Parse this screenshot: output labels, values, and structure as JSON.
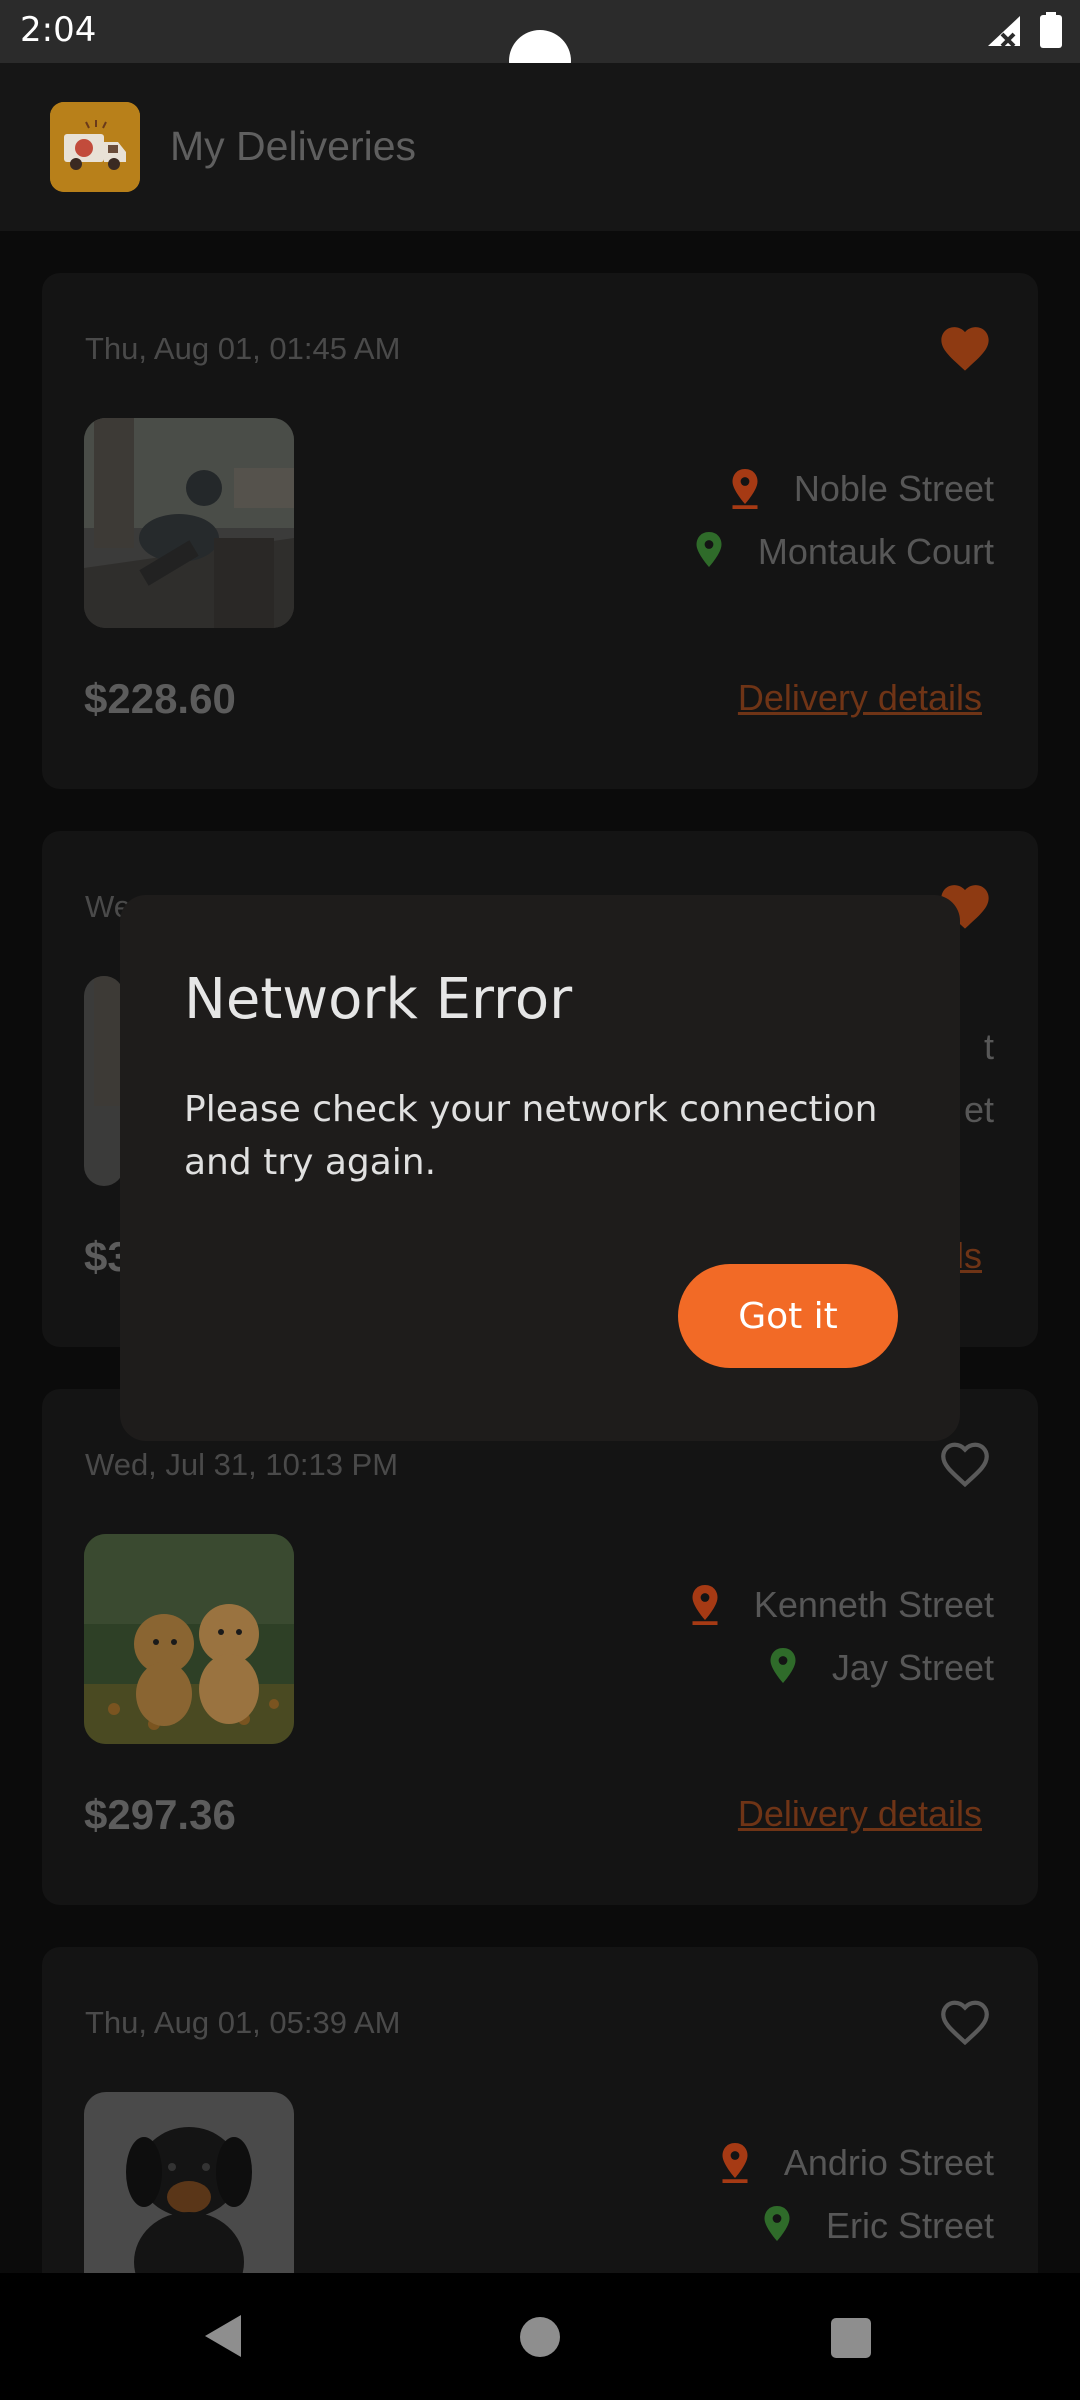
{
  "status_bar": {
    "time": "2:04"
  },
  "app_bar": {
    "title": "My Deliveries"
  },
  "cards": [
    {
      "date": "Thu, Aug 01, 01:45 AM",
      "favorite": true,
      "pickup": "Noble Street",
      "dropoff": "Montauk Court",
      "price": "$228.60",
      "details_label": "Delivery details",
      "image": "cat-statue-photo"
    },
    {
      "date": "Wed, Jul 31, 10:13 PM",
      "favorite": false,
      "pickup": "Kenneth Street",
      "dropoff": "Jay Street",
      "price": "$297.36",
      "details_label": "Delivery details",
      "image": "puppies-photo"
    },
    {
      "date": "Thu, Aug 01, 05:39 AM",
      "favorite": false,
      "pickup": "Andrio Street",
      "dropoff": "Eric Street",
      "image": "dog-photo"
    }
  ],
  "partial_card": {
    "date_fragment": "We",
    "street_fragment_1": "t",
    "street_fragment_2": "et",
    "price_fragment": "$3",
    "details_fragment": "ls"
  },
  "dialog": {
    "title": "Network Error",
    "message": "Please check your network connection and try again.",
    "button_label": "Got it"
  },
  "colors": {
    "accent": "#f26a26",
    "pickup_pin": "#a63a14",
    "dropoff_pin": "#2f6b2a",
    "dialog_bg": "#1e1c1b"
  }
}
